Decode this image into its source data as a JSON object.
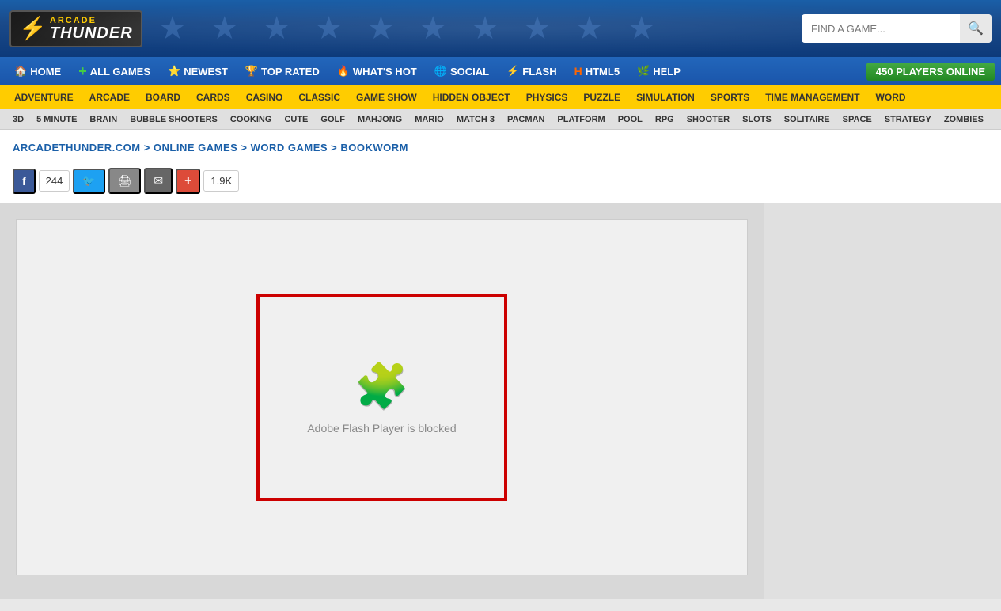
{
  "header": {
    "logo": {
      "arcade": "ARCADE",
      "thunder": "THUNDER"
    },
    "search": {
      "placeholder": "FIND A GAME...",
      "button_icon": "🔍"
    },
    "nav_main": [
      {
        "label": "HOME",
        "icon": "🏠",
        "icon_name": "home-icon"
      },
      {
        "label": "ALL GAMES",
        "icon": "➕",
        "icon_name": "allgames-icon"
      },
      {
        "label": "NEWEST",
        "icon": "⭐",
        "icon_name": "newest-icon"
      },
      {
        "label": "TOP RATED",
        "icon": "🏆",
        "icon_name": "toprated-icon"
      },
      {
        "label": "WHAT'S HOT",
        "icon": "🔥",
        "icon_name": "hot-icon"
      },
      {
        "label": "SOCIAL",
        "icon": "🌐",
        "icon_name": "social-icon"
      },
      {
        "label": "FLASH",
        "icon": "⚡",
        "icon_name": "flash-icon"
      },
      {
        "label": "HTML5",
        "icon": "5️⃣",
        "icon_name": "html5-icon"
      },
      {
        "label": "HELP",
        "icon": "🌿",
        "icon_name": "help-icon"
      }
    ],
    "players_online": "450 PLAYERS ONLINE",
    "nav_categories": [
      "ADVENTURE",
      "ARCADE",
      "BOARD",
      "CARDS",
      "CASINO",
      "CLASSIC",
      "GAME SHOW",
      "HIDDEN OBJECT",
      "PHYSICS",
      "PUZZLE",
      "SIMULATION",
      "SPORTS",
      "TIME MANAGEMENT",
      "WORD"
    ],
    "nav_sub": [
      "3D",
      "5 MINUTE",
      "BRAIN",
      "BUBBLE SHOOTERS",
      "COOKING",
      "CUTE",
      "GOLF",
      "MAHJONG",
      "MARIO",
      "MATCH 3",
      "PACMAN",
      "PLATFORM",
      "POOL",
      "RPG",
      "SHOOTER",
      "SLOTS",
      "SOLITAIRE",
      "SPACE",
      "STRATEGY",
      "ZOMBIES"
    ]
  },
  "breadcrumb": "ARCADETHUNDER.COM > ONLINE GAMES > WORD GAMES > BOOKWORM",
  "share": {
    "fb_label": "f",
    "fb_count": "244",
    "twitter_label": "🐦",
    "print_label": "🖨",
    "email_label": "✉",
    "plus_label": "+",
    "plus_count": "1.9K"
  },
  "game": {
    "flash_blocked_text": "Adobe Flash Player is blocked",
    "puzzle_icon": "🧩"
  }
}
